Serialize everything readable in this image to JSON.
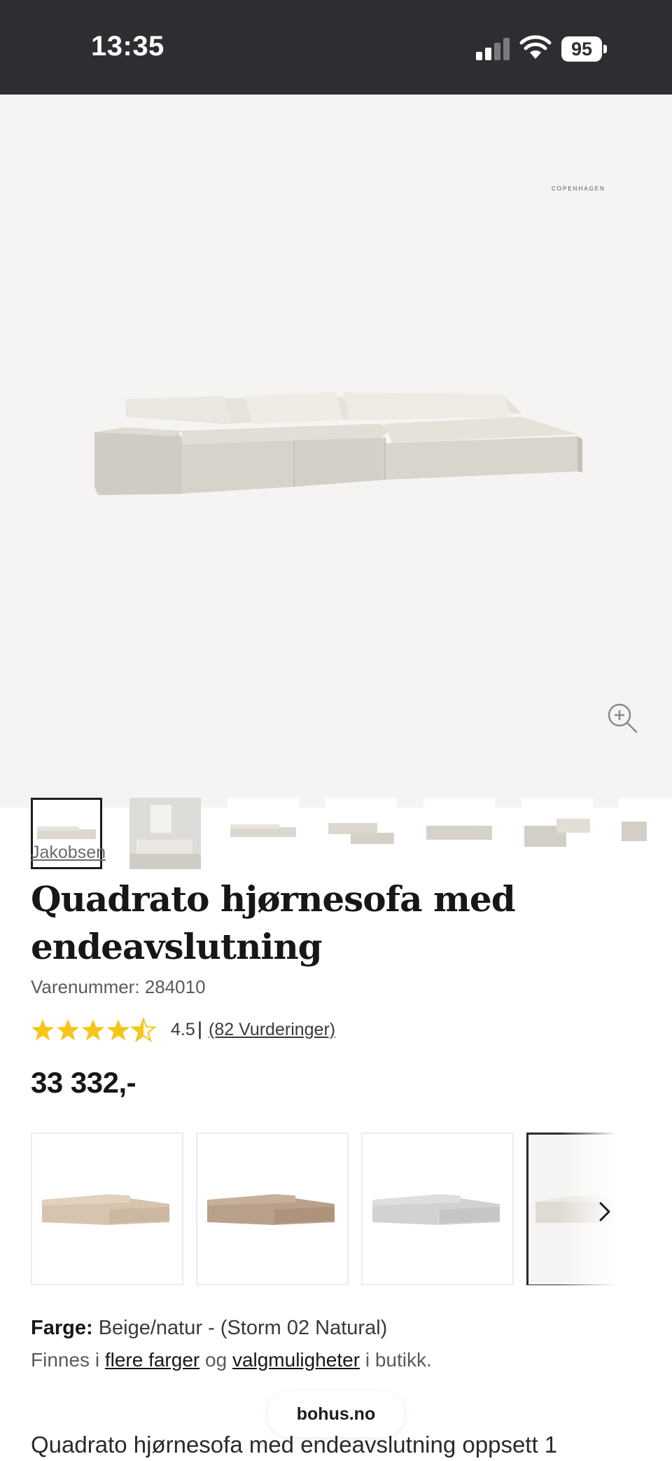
{
  "status_bar": {
    "time": "13:35",
    "battery": "95",
    "icons": [
      "signal-icon",
      "wifi-icon",
      "battery-icon"
    ]
  },
  "gallery": {
    "brand_mark": "COPENHAGEN",
    "zoom_icon": "zoom-in-icon",
    "thumbnail_count": 7,
    "selected_thumbnail": 1
  },
  "product": {
    "brand": "Jakobsen",
    "title_line1": "Quadrato hjørnesofa med",
    "title_line2": "endeavslutning",
    "sku": "Varenummer: 284010",
    "rating": {
      "stars": 4.5,
      "value": "4.5",
      "separator": "|",
      "count": "(82 Vurderinger)",
      "star_color": "#f5c518"
    },
    "price": "33 332,-"
  },
  "swatches": {
    "items": [
      {
        "name": "Beige",
        "color": "#d6c4ae"
      },
      {
        "name": "Brown",
        "color": "#b9a08a"
      },
      {
        "name": "Grey",
        "color": "#d2d2d4"
      },
      {
        "name": "Natural",
        "color": "#e8e3da"
      }
    ],
    "selected_index": 3,
    "next_icon": "chevron-right-icon"
  },
  "color_info": {
    "label": "Farge:",
    "value": " Beige/natur - (Storm 02 Natural)",
    "avail_prefix": "Finnes i ",
    "avail_link1": "flere farger",
    "avail_mid": " og ",
    "avail_link2": "valgmuligheter",
    "avail_suffix": " i butikk."
  },
  "url_pill": "bohus.no",
  "description": "Quadrato hjørnesofa med endeavslutning oppsett 1"
}
